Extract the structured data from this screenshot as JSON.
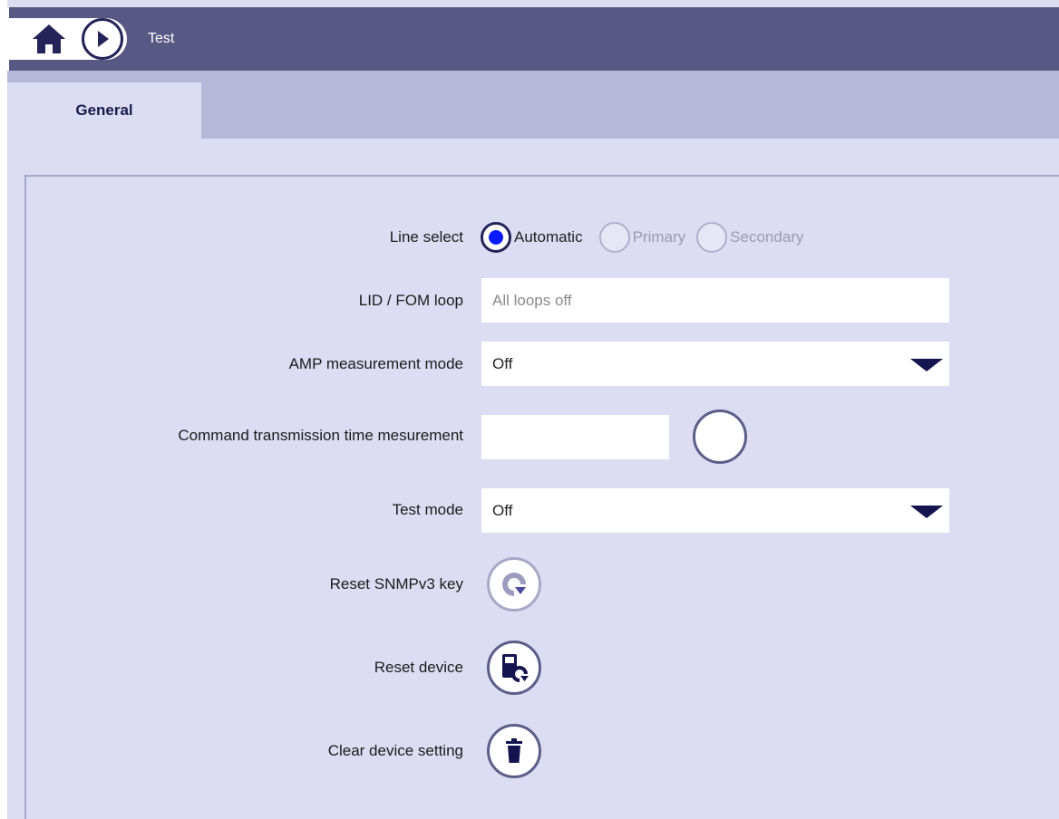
{
  "header": {
    "breadcrumb": "Test",
    "home_icon": "home-icon",
    "next_icon": "play-right-icon"
  },
  "tabs": [
    {
      "label": "General",
      "active": true
    }
  ],
  "form": {
    "line_select": {
      "label": "Line select",
      "options": [
        {
          "label": "Automatic",
          "selected": true,
          "enabled": true
        },
        {
          "label": "Primary",
          "selected": false,
          "enabled": false
        },
        {
          "label": "Secondary",
          "selected": false,
          "enabled": false
        }
      ]
    },
    "lid_fom_loop": {
      "label": "LID / FOM loop",
      "placeholder": "All loops off"
    },
    "amp_mode": {
      "label": "AMP measurement mode",
      "value": "Off"
    },
    "cmd_time": {
      "label": "Command transmission time mesurement",
      "value": ""
    },
    "test_mode": {
      "label": "Test mode",
      "value": "Off"
    },
    "reset_snmp": {
      "label": "Reset SNMPv3 key",
      "icon": "refresh-icon"
    },
    "reset_device": {
      "label": "Reset device",
      "icon": "device-reset-icon"
    },
    "clear_setting": {
      "label": "Clear device setting",
      "icon": "trash-icon"
    }
  },
  "colors": {
    "header": "#585884",
    "tabbar": "#b7b7d9",
    "background": "#dcdcf2",
    "accent": "#24245a",
    "radio_selected": "#0b1bff"
  }
}
